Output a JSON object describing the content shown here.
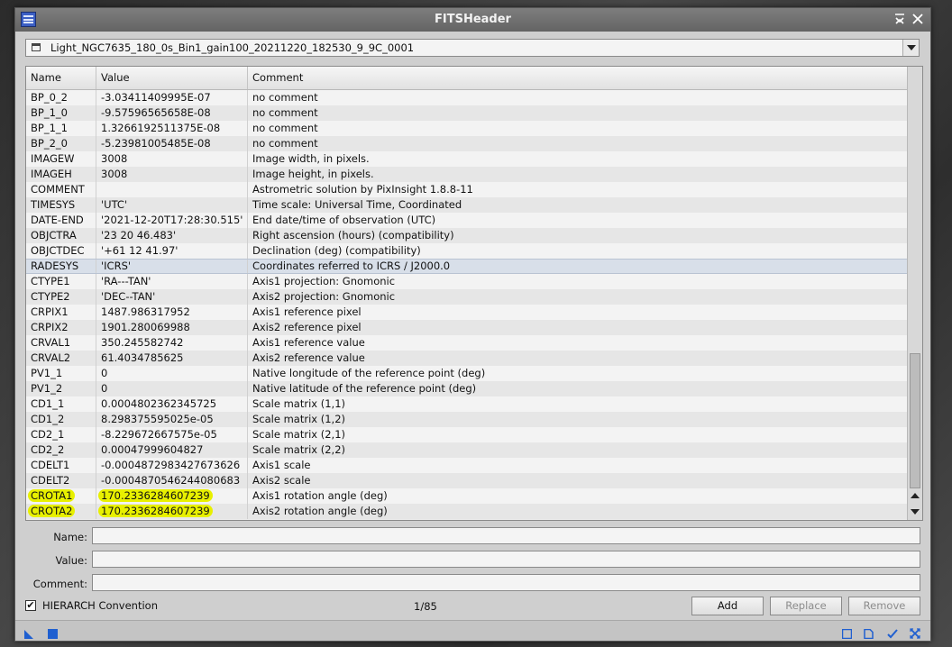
{
  "window": {
    "title": "FITSHeader"
  },
  "file_selector": {
    "value": "Light_NGC7635_180_0s_Bin1_gain100_20211220_182530_9_9C_0001"
  },
  "table": {
    "columns": [
      "Name",
      "Value",
      "Comment"
    ],
    "rows": [
      {
        "name": "BP_0_2",
        "value": "-3.03411409995E-07",
        "comment": "no comment"
      },
      {
        "name": "BP_1_0",
        "value": "-9.57596565658E-08",
        "comment": "no comment"
      },
      {
        "name": "BP_1_1",
        "value": "1.3266192511375E-08",
        "comment": "no comment"
      },
      {
        "name": "BP_2_0",
        "value": "-5.23981005485E-08",
        "comment": "no comment"
      },
      {
        "name": "IMAGEW",
        "value": "3008",
        "comment": "Image width,  in pixels."
      },
      {
        "name": "IMAGEH",
        "value": "3008",
        "comment": "Image height, in pixels."
      },
      {
        "name": "COMMENT",
        "value": "",
        "comment": "Astrometric solution by PixInsight 1.8.8-11"
      },
      {
        "name": "TIMESYS",
        "value": "'UTC'",
        "comment": "Time scale: Universal Time, Coordinated"
      },
      {
        "name": "DATE-END",
        "value": "'2021-12-20T17:28:30.515'",
        "comment": "End date/time of observation (UTC)"
      },
      {
        "name": "OBJCTRA",
        "value": "'23 20 46.483'",
        "comment": "Right ascension (hours) (compatibility)"
      },
      {
        "name": "OBJCTDEC",
        "value": "'+61 12 41.97'",
        "comment": "Declination (deg) (compatibility)"
      },
      {
        "name": "RADESYS",
        "value": "'ICRS'",
        "comment": "Coordinates referred to ICRS / J2000.0"
      },
      {
        "name": "CTYPE1",
        "value": "'RA---TAN'",
        "comment": "Axis1 projection: Gnomonic"
      },
      {
        "name": "CTYPE2",
        "value": "'DEC--TAN'",
        "comment": "Axis2 projection: Gnomonic"
      },
      {
        "name": "CRPIX1",
        "value": "1487.986317952",
        "comment": "Axis1 reference pixel"
      },
      {
        "name": "CRPIX2",
        "value": "1901.280069988",
        "comment": "Axis2 reference pixel"
      },
      {
        "name": "CRVAL1",
        "value": "350.245582742",
        "comment": "Axis1 reference value"
      },
      {
        "name": "CRVAL2",
        "value": "61.4034785625",
        "comment": "Axis2 reference value"
      },
      {
        "name": "PV1_1",
        "value": "0",
        "comment": "Native longitude of the reference point (deg)"
      },
      {
        "name": "PV1_2",
        "value": "0",
        "comment": "Native latitude of the reference point (deg)"
      },
      {
        "name": "CD1_1",
        "value": "0.0004802362345725",
        "comment": "Scale matrix (1,1)"
      },
      {
        "name": "CD1_2",
        "value": "8.298375595025e-05",
        "comment": "Scale matrix (1,2)"
      },
      {
        "name": "CD2_1",
        "value": "-8.229672667575e-05",
        "comment": "Scale matrix (2,1)"
      },
      {
        "name": "CD2_2",
        "value": "0.00047999604827",
        "comment": "Scale matrix (2,2)"
      },
      {
        "name": "CDELT1",
        "value": "-0.0004872983427673626",
        "comment": "Axis1 scale"
      },
      {
        "name": "CDELT2",
        "value": "-0.0004870546244080683",
        "comment": "Axis2 scale"
      },
      {
        "name": "CROTA1",
        "value": "170.2336284607239",
        "comment": "Axis1 rotation angle (deg)"
      },
      {
        "name": "CROTA2",
        "value": "170.2336284607239",
        "comment": "Axis2 rotation angle (deg)"
      }
    ]
  },
  "form": {
    "name_label": "Name:",
    "value_label": "Value:",
    "comment_label": "Comment:",
    "name_value": "",
    "value_value": "",
    "comment_value": ""
  },
  "footer": {
    "hierarch_label": "HIERARCH Convention",
    "hierarch_checked": "✔",
    "counter": "1/85",
    "add_label": "Add",
    "replace_label": "Replace",
    "remove_label": "Remove"
  },
  "colors": {
    "highlight": "#e8f000",
    "title_bar": "#6e6e6e",
    "accent_icon": "#1f5fd0"
  }
}
